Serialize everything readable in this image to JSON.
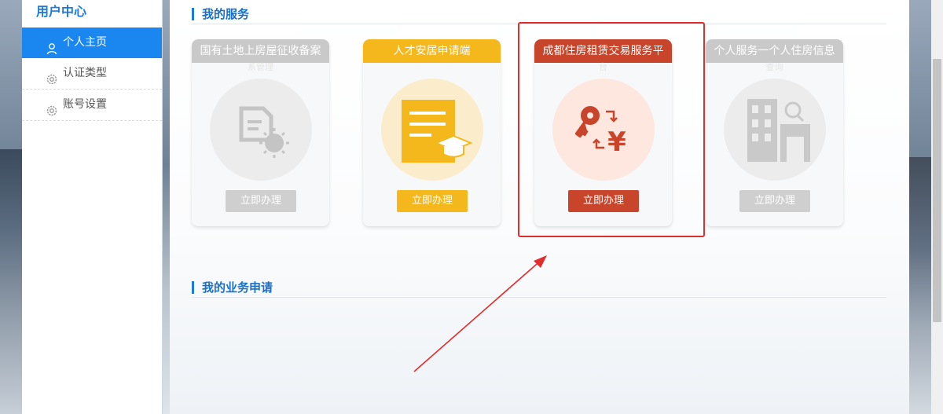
{
  "sidebar": {
    "title": "用户中心",
    "items": [
      {
        "label": "个人主页",
        "icon": "user-icon",
        "active": true
      },
      {
        "label": "认证类型",
        "icon": "gear-icon",
        "active": false
      },
      {
        "label": "账号设置",
        "icon": "gear-icon",
        "active": false
      }
    ]
  },
  "services": {
    "title": "我的服务",
    "cards": [
      {
        "title": "国有土地上房屋征收备案",
        "subtitle": "系管理",
        "button": "立即办理",
        "icon": "document-gear-icon",
        "color": "#c9c9c9"
      },
      {
        "title": "人才安居申请端",
        "subtitle": "",
        "button": "立即办理",
        "icon": "certificate-graduation-icon",
        "color": "#f5b81c"
      },
      {
        "title": "成都住房租赁交易服务平",
        "subtitle": "台",
        "button": "立即办理",
        "icon": "key-yuan-exchange-icon",
        "color": "#c8452b"
      },
      {
        "title": "个人服务一个人住房信息",
        "subtitle": "查询",
        "button": "立即办理",
        "icon": "building-search-icon",
        "color": "#c9c9c9"
      }
    ]
  },
  "applications": {
    "title": "我的业务申请"
  },
  "colors": {
    "accent": "#1a7ae0",
    "highlight": "#e02d2d"
  }
}
